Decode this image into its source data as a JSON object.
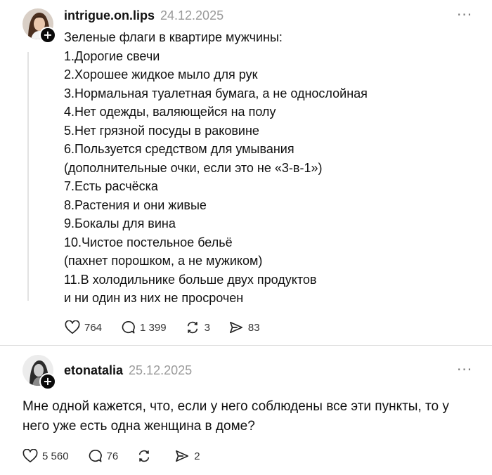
{
  "post1": {
    "username": "intrigue.on.lips",
    "date": "24.12.2025",
    "lines": [
      "Зеленые флаги в квартире мужчины:",
      "1.Дорогие свечи",
      "2.Хорошее жидкое мыло для рук",
      "3.Нормальная туалетная бумага, а не однослойная",
      "4.Нет одежды, валяющейся на полу",
      "5.Нет грязной посуды в раковине",
      "6.Пользуется средством для умывания",
      "(дополнительные очки, если это не «3-в-1»)",
      "7.Есть расчёска",
      "8.Растения и они живые",
      "9.Бокалы для вина",
      "10.Чистое постельное бельё",
      "(пахнет порошком, а не мужиком)",
      "11.В холодильнике больше двух продуктов",
      "и ни один из них не просрочен"
    ],
    "likes": "764",
    "comments": "1 399",
    "reposts": "3",
    "shares": "83"
  },
  "post2": {
    "username": "etonatalia",
    "date": "25.12.2025",
    "text_line1": "Мне одной кажется, что, если у него соблюдены все эти пункты, то у",
    "text_line2": "него уже есть одна женщина в доме?",
    "likes": "5 560",
    "comments": "76",
    "reposts": "",
    "shares": "2"
  },
  "icons": {
    "plus_symbol": "+",
    "more_symbol": "···"
  },
  "colors": {
    "text": "#111111",
    "muted": "#9a9a9a",
    "divider": "#dcdcdc"
  }
}
